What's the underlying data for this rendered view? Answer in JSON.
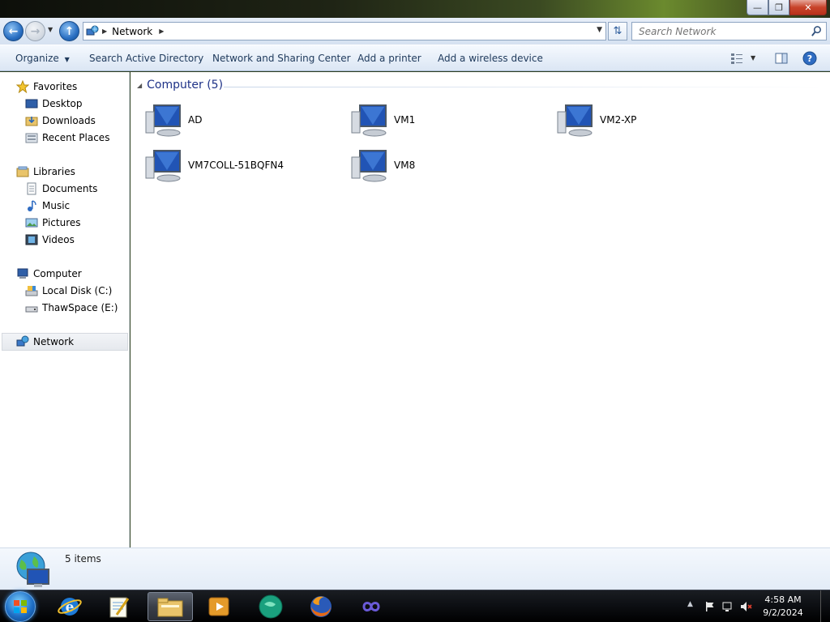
{
  "window": {
    "caption_buttons": [
      "minimize",
      "restore",
      "close"
    ]
  },
  "address_bar": {
    "breadcrumb": "Network",
    "search_placeholder": "Search Network"
  },
  "command_bar": {
    "organize": "Organize",
    "search_ad": "Search Active Directory",
    "network_center": "Network and Sharing Center",
    "add_printer": "Add a printer",
    "add_wireless": "Add a wireless device"
  },
  "nav_pane": {
    "favorites": "Favorites",
    "desktop": "Desktop",
    "downloads": "Downloads",
    "recent": "Recent Places",
    "libraries": "Libraries",
    "documents": "Documents",
    "music": "Music",
    "pictures": "Pictures",
    "videos": "Videos",
    "computer": "Computer",
    "local_disk": "Local Disk (C:)",
    "thawspace": "ThawSpace (E:)",
    "network": "Network"
  },
  "content": {
    "group_title": "Computer (5)",
    "computers": [
      "AD",
      "VM1",
      "VM2-XP",
      "VM7COLL-51BQFN4",
      "VM8"
    ]
  },
  "details": {
    "item_count": "5 items"
  },
  "taskbar": {
    "time": "4:58 AM",
    "date": "9/2/2024"
  },
  "colors": {
    "accent": "#1e3287",
    "command_text": "#1e395b",
    "selection": "#e6e9ee"
  }
}
